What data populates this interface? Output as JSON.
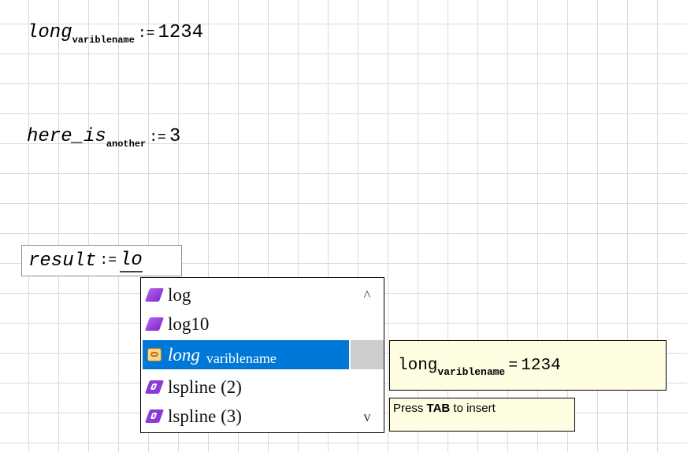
{
  "worksheet": {
    "line1": {
      "base": "long",
      "subscript": "varible­name",
      "assign": ":=",
      "value": "1234"
    },
    "line2": {
      "base": "here_is",
      "subscript": "another",
      "assign": ":=",
      "value": "3"
    },
    "edit": {
      "var": "result",
      "assign": ":=",
      "typed": "lo"
    }
  },
  "autocomplete": {
    "items": [
      {
        "label": "log",
        "kind": "function"
      },
      {
        "label": "log10",
        "kind": "function"
      },
      {
        "label": "long",
        "subscript": "varible­name",
        "kind": "variable",
        "selected": true
      },
      {
        "label": "lspline (2)",
        "kind": "program-function"
      },
      {
        "label": "lspline (3)",
        "kind": "program-function"
      }
    ],
    "scroll_up": "^",
    "scroll_down": "v"
  },
  "preview": {
    "base": "long",
    "subscript": "varible­name",
    "equals": "=",
    "value": "1234"
  },
  "tooltip": {
    "prefix": "Press ",
    "key": "TAB",
    "suffix": " to insert"
  },
  "colors": {
    "selection": "#0078d7",
    "tooltip_bg": "#fffde1",
    "function_icon": "#9b45e4"
  }
}
